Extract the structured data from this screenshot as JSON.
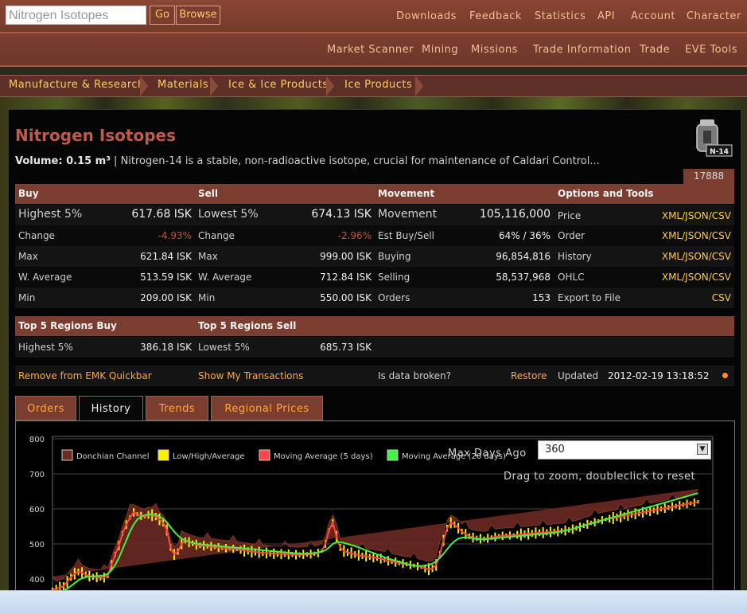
{
  "header": {
    "search_value": "Nitrogen Isotopes",
    "go_label": "Go",
    "browse_label": "Browse",
    "top_nav": [
      "Downloads",
      "Feedback",
      "Statistics",
      "API",
      "Account",
      "Character"
    ],
    "sub_nav": [
      "Market Scanner",
      "Mining",
      "Missions",
      "Trade Information",
      "Trade",
      "EVE Tools"
    ]
  },
  "breadcrumb": [
    "Manufacture & Research",
    "Materials",
    "Ice & Ice Products",
    "Ice Products"
  ],
  "item": {
    "name": "Nitrogen Isotopes",
    "volume_label": "Volume: 0.15 m³",
    "description": " | Nitrogen-14 is a stable, non-radioactive isotope, crucial for maintenance of Caldari Control...",
    "icon_label": "N-14",
    "type_id": "17888"
  },
  "stats": {
    "headers": {
      "buy": "Buy",
      "sell": "Sell",
      "movement": "Movement",
      "options": "Options and Tools"
    },
    "rows": [
      {
        "buy_label": "Highest 5%",
        "buy_value": "617.68 ISK",
        "sell_label": "Lowest 5%",
        "sell_value": "674.13 ISK",
        "mov_label": "Movement",
        "mov_value": "105,116,000",
        "opt_label": "Price",
        "opt_value": "XML/JSON/CSV"
      },
      {
        "buy_label": "Change",
        "buy_value": "-4.93%",
        "sell_label": "Change",
        "sell_value": "-2.96%",
        "mov_label": "Est Buy/Sell",
        "mov_value": "64% / 36%",
        "opt_label": "Order",
        "opt_value": "XML/JSON/CSV"
      },
      {
        "buy_label": "Max",
        "buy_value": "621.84 ISK",
        "sell_label": "Max",
        "sell_value": "999.00 ISK",
        "mov_label": "Buying",
        "mov_value": "96,854,816",
        "opt_label": "History",
        "opt_value": "XML/JSON/CSV"
      },
      {
        "buy_label": "W. Average",
        "buy_value": "513.59 ISK",
        "sell_label": "W. Average",
        "sell_value": "712.84 ISK",
        "mov_label": "Selling",
        "mov_value": "58,537,968",
        "opt_label": "OHLC",
        "opt_value": "XML/JSON/CSV"
      },
      {
        "buy_label": "Min",
        "buy_value": "209.00 ISK",
        "sell_label": "Min",
        "sell_value": "550.00 ISK",
        "mov_label": "Orders",
        "mov_value": "153",
        "opt_label": "Export to File",
        "opt_value": "CSV"
      }
    ]
  },
  "regions": {
    "buy_header": "Top 5 Regions Buy",
    "sell_header": "Top 5 Regions Sell",
    "buy_label": "Highest 5%",
    "buy_value": "386.18 ISK",
    "sell_label": "Lowest 5%",
    "sell_value": "685.73 ISK"
  },
  "actions": {
    "quickbar": "Remove from EMK Quickbar",
    "transactions": "Show My Transactions",
    "broken": "Is data broken?",
    "restore": "Restore",
    "updated_label": "Updated",
    "updated_value": "2012-02-19 13:18:52"
  },
  "tabs": [
    "Orders",
    "History",
    "Trends",
    "Regional Prices"
  ],
  "active_tab": "History",
  "chart_controls": {
    "max_days_label": "Max Days Ago",
    "max_days_value": "360",
    "zoom_hint": "Drag to zoom, doubleclick to reset"
  },
  "chart_data": {
    "type": "line",
    "legend": [
      "Donchian Channel",
      "Low/High/Average",
      "Moving Average (5 days)",
      "Moving Average (20 days)"
    ],
    "y_ticks": [
      "800",
      "700",
      "600",
      "500",
      "400"
    ],
    "ylim": [
      370,
      810
    ],
    "x": [
      0,
      2,
      4,
      6,
      8,
      10,
      12,
      14,
      16,
      18,
      20,
      22,
      24,
      26,
      28,
      30,
      32,
      34,
      36,
      38,
      40,
      42,
      44,
      46,
      48,
      50,
      52,
      54,
      56,
      58,
      60,
      62,
      64,
      66,
      68,
      70,
      72,
      74,
      76,
      78,
      80,
      82,
      84,
      86,
      88,
      90,
      92,
      94,
      96,
      98,
      100,
      102,
      104,
      106,
      108,
      110,
      112,
      114,
      116,
      118,
      120,
      122,
      124,
      126,
      128,
      130,
      132,
      134,
      136,
      138,
      140,
      142,
      144,
      146,
      148,
      150,
      152,
      154,
      156,
      158,
      160,
      162,
      164,
      166,
      168,
      170,
      172,
      174,
      176,
      178,
      180,
      182,
      184,
      186,
      188,
      190,
      192,
      194,
      196,
      198,
      200,
      202,
      204,
      206,
      208,
      210,
      212,
      214,
      216,
      218,
      220,
      222,
      224,
      226,
      228,
      230,
      232,
      234,
      236,
      238,
      240,
      242,
      244,
      246,
      248,
      250,
      252,
      254,
      256,
      258,
      260,
      262,
      264,
      266,
      268,
      270,
      272,
      274,
      276,
      278,
      280,
      282,
      284,
      286,
      288,
      290,
      292,
      294,
      296,
      298,
      300,
      302,
      304,
      306,
      308,
      310,
      312,
      314,
      316,
      318,
      320,
      322,
      324,
      326,
      328,
      330,
      332,
      334,
      336,
      338,
      340,
      342,
      344,
      346,
      348,
      350,
      352,
      354,
      356,
      358
    ],
    "series": [
      {
        "name": "Moving Average (5 days)",
        "color": "#ff4444",
        "values": [
          370,
          372,
          375,
          380,
          392,
          405,
          415,
          420,
          418,
          412,
          408,
          406,
          405,
          404,
          404,
          410,
          440,
          470,
          495,
          530,
          555,
          575,
          590,
          585,
          580,
          578,
          583,
          582,
          578,
          570,
          560,
          540,
          490,
          470,
          478,
          500,
          510,
          505,
          502,
          498,
          496,
          495,
          494,
          493,
          492,
          490,
          489,
          488,
          487,
          486,
          485,
          483,
          481,
          480,
          478,
          477,
          476,
          475,
          474,
          473,
          472,
          472,
          471,
          471,
          470,
          470,
          469,
          469,
          470,
          470,
          471,
          472,
          474,
          480,
          500,
          540,
          560,
          520,
          490,
          480,
          476,
          474,
          470,
          468,
          466,
          465,
          463,
          462,
          460,
          458,
          455,
          452,
          450,
          448,
          446,
          444,
          442,
          440,
          438,
          436,
          434,
          430,
          428,
          430,
          440,
          470,
          510,
          545,
          560,
          555,
          545,
          535,
          528,
          522,
          518,
          516,
          515,
          514,
          516,
          518,
          520,
          522,
          523,
          524,
          524,
          525,
          526,
          527,
          528,
          529,
          530,
          531,
          532,
          532,
          533,
          534,
          535,
          536,
          537,
          538,
          540,
          542,
          545,
          548,
          552,
          556,
          560,
          562,
          565,
          568,
          570,
          572,
          574,
          576,
          578,
          580,
          582,
          584,
          586,
          588,
          590,
          592,
          594,
          596,
          598,
          600,
          602,
          604,
          606,
          608,
          610,
          612,
          614,
          616,
          618,
          620
        ]
      },
      {
        "name": "Moving Average (20 days)",
        "color": "#44ee44",
        "values": [
          360,
          362,
          364,
          367,
          372,
          380,
          388,
          396,
          402,
          405,
          407,
          408,
          408,
          409,
          410,
          415,
          425,
          440,
          460,
          485,
          510,
          535,
          555,
          570,
          578,
          582,
          584,
          584,
          582,
          578,
          572,
          562,
          548,
          535,
          524,
          515,
          510,
          506,
          503,
          501,
          499,
          498,
          497,
          496,
          495,
          494,
          493,
          492,
          491,
          490,
          489,
          488,
          487,
          486,
          485,
          484,
          483,
          482,
          481,
          480,
          479,
          478,
          477,
          476,
          475,
          474,
          473,
          472,
          472,
          472,
          473,
          474,
          476,
          478,
          482,
          490,
          500,
          505,
          505,
          503,
          500,
          497,
          494,
          490,
          486,
          482,
          478,
          474,
          470,
          466,
          462,
          458,
          455,
          452,
          449,
          446,
          443,
          440,
          438,
          437,
          437,
          438,
          440,
          444,
          450,
          460,
          472,
          485,
          498,
          508,
          515,
          518,
          519,
          518,
          516,
          514,
          513,
          513,
          514,
          515,
          516,
          517,
          518,
          519,
          520,
          521,
          522,
          523,
          524,
          525,
          526,
          527,
          528,
          529,
          530,
          531,
          532,
          534,
          536,
          538,
          540,
          543,
          546,
          549,
          552,
          555,
          558,
          561,
          564,
          567,
          570,
          573,
          576,
          579,
          582,
          585,
          588,
          591,
          594,
          597,
          600,
          603,
          606,
          609,
          612,
          615,
          618,
          621,
          624,
          627,
          630,
          633,
          636,
          639,
          642,
          645
        ]
      }
    ]
  }
}
